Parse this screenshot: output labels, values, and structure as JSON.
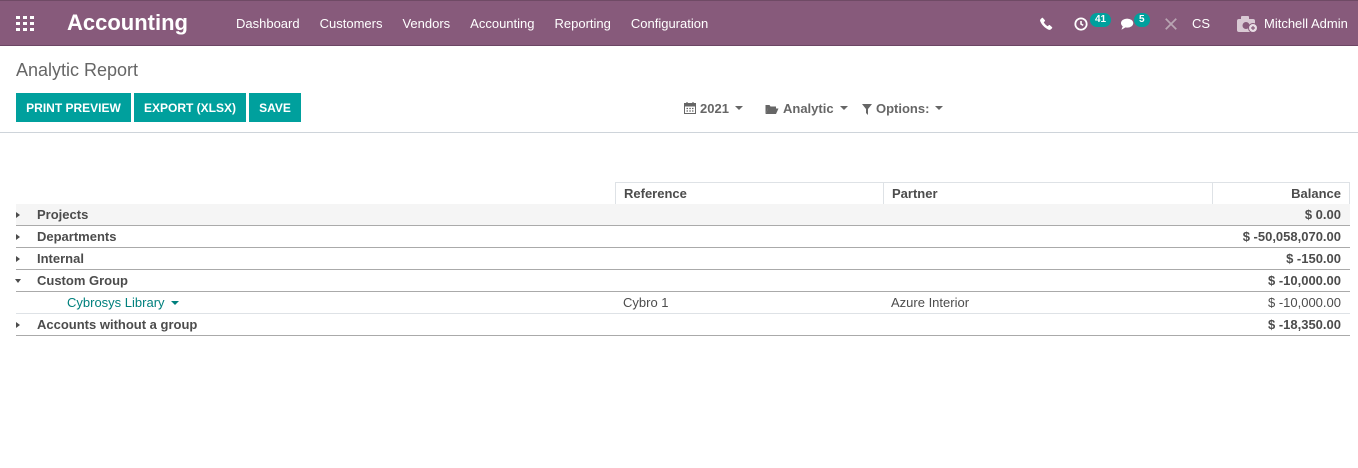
{
  "navbar": {
    "app_title": "Accounting",
    "menu": [
      "Dashboard",
      "Customers",
      "Vendors",
      "Accounting",
      "Reporting",
      "Configuration"
    ],
    "activities_count": "41",
    "messages_count": "5",
    "company": "CS",
    "user": "Mitchell Admin"
  },
  "page": {
    "title": "Analytic Report",
    "buttons": {
      "print_preview": "Print Preview",
      "export_xlsx": "Export (XLSX)",
      "save": "Save"
    },
    "filters": {
      "date": "2021",
      "analytic": "Analytic",
      "options": "Options:"
    }
  },
  "report": {
    "columns": [
      "Reference",
      "Partner",
      "Balance"
    ],
    "rows": [
      {
        "name": "Projects",
        "balance": "$ 0.00",
        "expanded": false
      },
      {
        "name": "Departments",
        "balance": "$ -50,058,070.00",
        "expanded": false
      },
      {
        "name": "Internal",
        "balance": "$ -150.00",
        "expanded": false
      },
      {
        "name": "Custom Group",
        "balance": "$ -10,000.00",
        "expanded": true
      },
      {
        "name": "Cybrosys Library",
        "reference": "Cybro 1",
        "partner": "Azure Interior",
        "balance": "$ -10,000.00"
      },
      {
        "name": "Accounts without a group",
        "balance": "$ -18,350.00",
        "expanded": false
      }
    ]
  },
  "colors": {
    "navbar": "#875a7b",
    "primary": "#00a09d",
    "link": "#00807d"
  }
}
